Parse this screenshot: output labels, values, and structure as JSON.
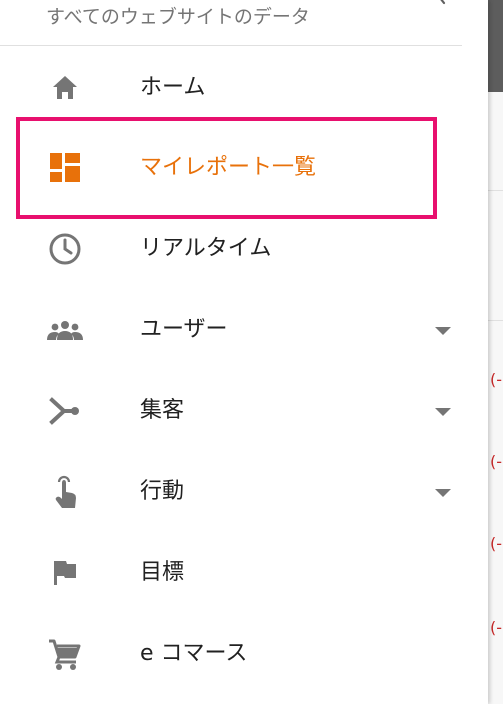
{
  "header": {
    "title": "すべてのウェブサイトのデータ",
    "chevron_icon": "chevron-right-icon"
  },
  "nav": {
    "items": [
      {
        "label": "ホーム",
        "icon": "home-icon",
        "expandable": false,
        "active": false
      },
      {
        "label": "マイレポート一覧",
        "icon": "dashboard-icon",
        "expandable": false,
        "active": true
      },
      {
        "label": "リアルタイム",
        "icon": "clock-icon",
        "expandable": false,
        "active": false
      },
      {
        "label": "ユーザー",
        "icon": "people-icon",
        "expandable": true,
        "active": false
      },
      {
        "label": "集客",
        "icon": "acquisition-icon",
        "expandable": true,
        "active": false
      },
      {
        "label": "行動",
        "icon": "touch-icon",
        "expandable": true,
        "active": false
      },
      {
        "label": "目標",
        "icon": "flag-icon",
        "expandable": false,
        "active": false
      },
      {
        "label": "e コマース",
        "icon": "cart-icon",
        "expandable": false,
        "active": false
      }
    ]
  },
  "colors": {
    "icon_gray": "#757575",
    "active_orange": "#e8710a",
    "highlight_pink": "#e8106e",
    "text": "#212121",
    "header_text": "#757575"
  },
  "background_marks": [
    "(-",
    "(-",
    "(-",
    "(-"
  ]
}
